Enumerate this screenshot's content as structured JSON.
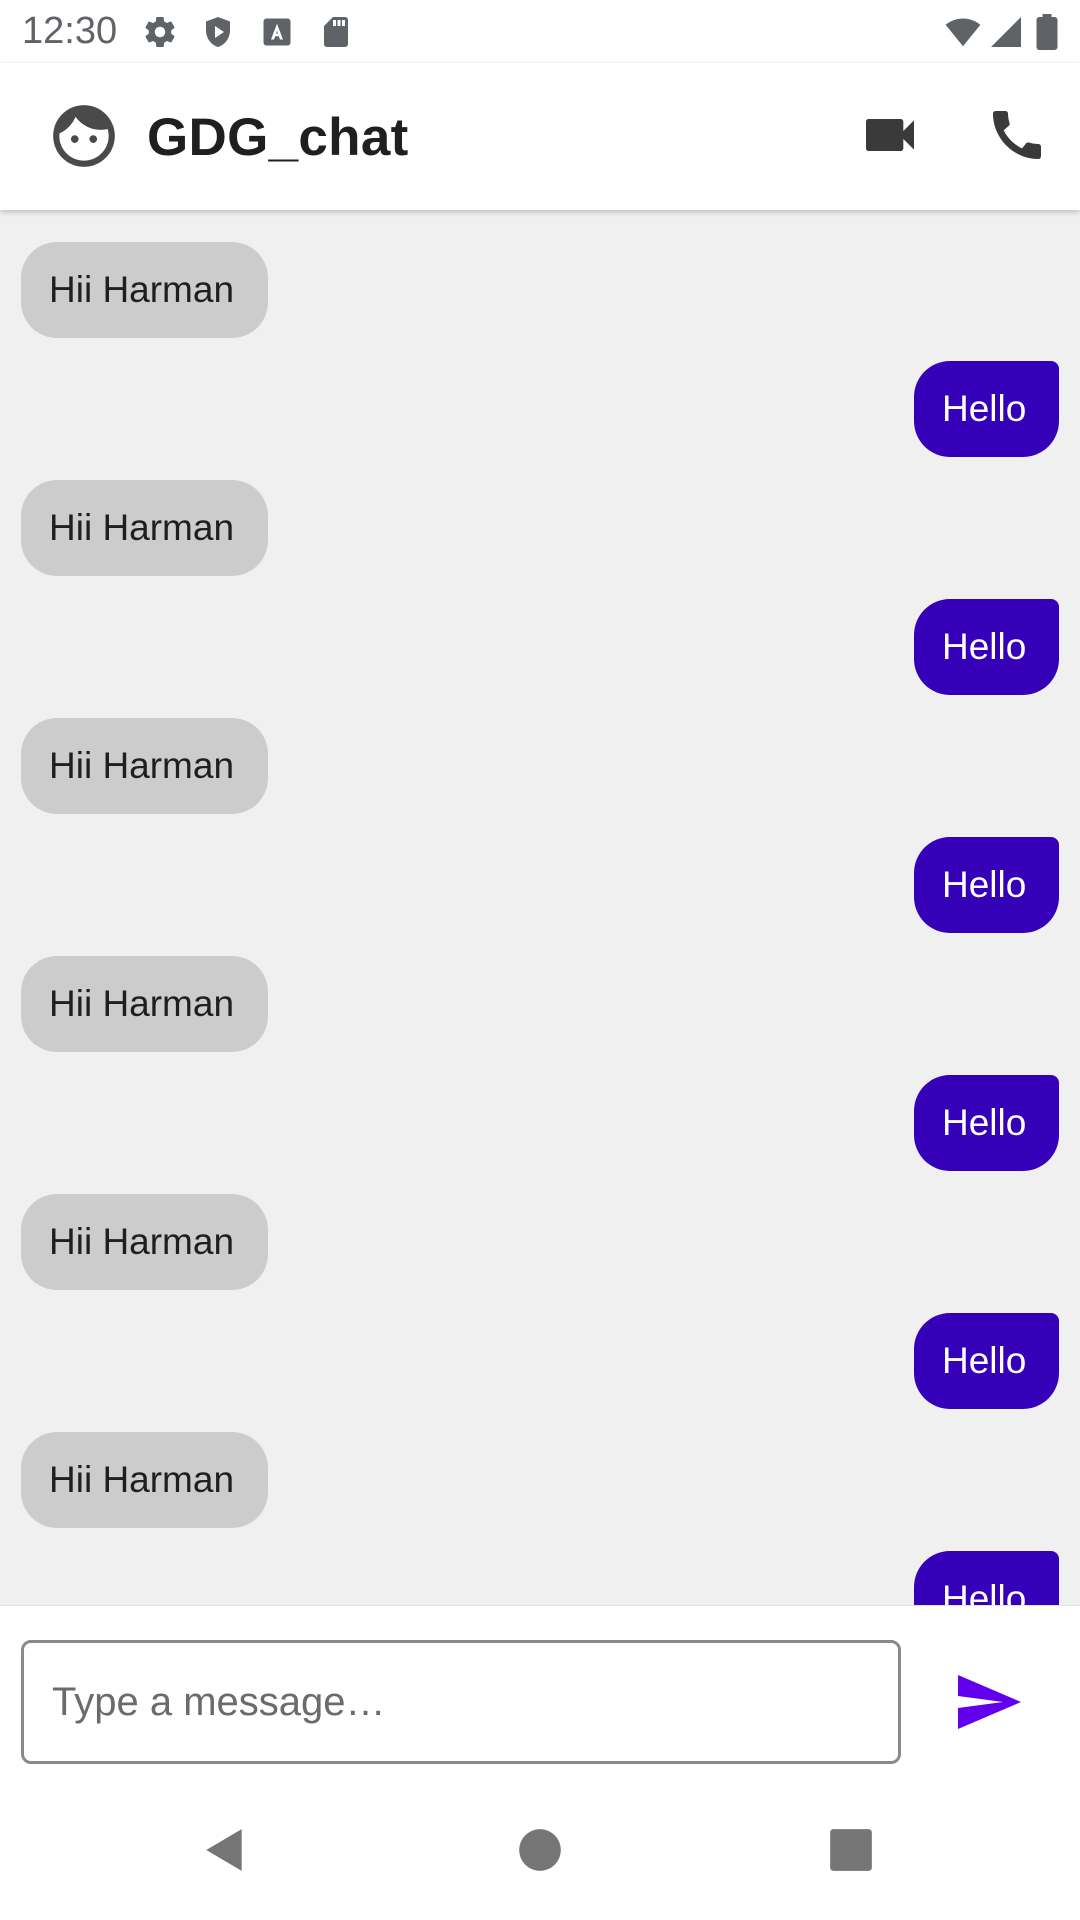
{
  "status_bar": {
    "time": "12:30",
    "icons": [
      "gear-icon",
      "shield-play-icon",
      "font-a-icon",
      "sd-card-icon",
      "wifi-icon",
      "cell-signal-icon",
      "battery-icon"
    ]
  },
  "app_bar": {
    "avatar_icon": "face-avatar-icon",
    "title": "GDG_chat",
    "actions": [
      "video-call-icon",
      "phone-icon"
    ]
  },
  "colors": {
    "incoming_bubble": "#cccccc",
    "outgoing_bubble": "#3500b8",
    "send_accent": "#6200ee",
    "chat_background": "#f0f0f1"
  },
  "messages": [
    {
      "direction": "incoming",
      "text": "Hii Harman"
    },
    {
      "direction": "outgoing",
      "text": "Hello"
    },
    {
      "direction": "incoming",
      "text": "Hii Harman"
    },
    {
      "direction": "outgoing",
      "text": "Hello"
    },
    {
      "direction": "incoming",
      "text": "Hii Harman"
    },
    {
      "direction": "outgoing",
      "text": "Hello"
    },
    {
      "direction": "incoming",
      "text": "Hii Harman"
    },
    {
      "direction": "outgoing",
      "text": "Hello"
    },
    {
      "direction": "incoming",
      "text": "Hii Harman"
    },
    {
      "direction": "outgoing",
      "text": "Hello"
    },
    {
      "direction": "incoming",
      "text": "Hii Harman"
    },
    {
      "direction": "outgoing",
      "text": "Hello"
    }
  ],
  "composer": {
    "placeholder": "Type a message…",
    "value": "",
    "send_icon": "send-icon"
  },
  "nav_bar": {
    "buttons": [
      "back-icon",
      "home-icon",
      "recents-icon"
    ]
  }
}
